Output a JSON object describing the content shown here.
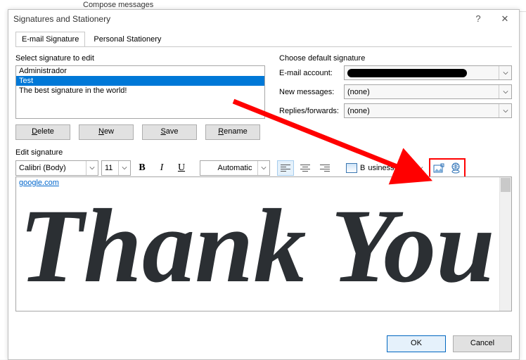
{
  "bg_menu": "Compose messages",
  "window": {
    "title": "Signatures and Stationery"
  },
  "tabs": {
    "email": "E-mail Signature",
    "stationery": "Personal Stationery"
  },
  "left": {
    "select_label": "Select signature to edit",
    "items": [
      "Administrador",
      "Test",
      "The best signature in the world!"
    ],
    "selected_index": 1,
    "buttons": {
      "delete": "Delete",
      "new": "New",
      "save": "Save",
      "rename": "Rename"
    }
  },
  "right": {
    "choose_label": "Choose default signature",
    "account_label": "E-mail account:",
    "newmsg_label": "New messages:",
    "newmsg_value": "(none)",
    "replies_label": "Replies/forwards:",
    "replies_value": "(none)"
  },
  "edit": {
    "label": "Edit signature",
    "font": "Calibri (Body)",
    "size": "11",
    "color": "Automatic",
    "business_card": "Business Card",
    "link_text": "google.com"
  },
  "footer": {
    "ok": "OK",
    "cancel": "Cancel"
  }
}
